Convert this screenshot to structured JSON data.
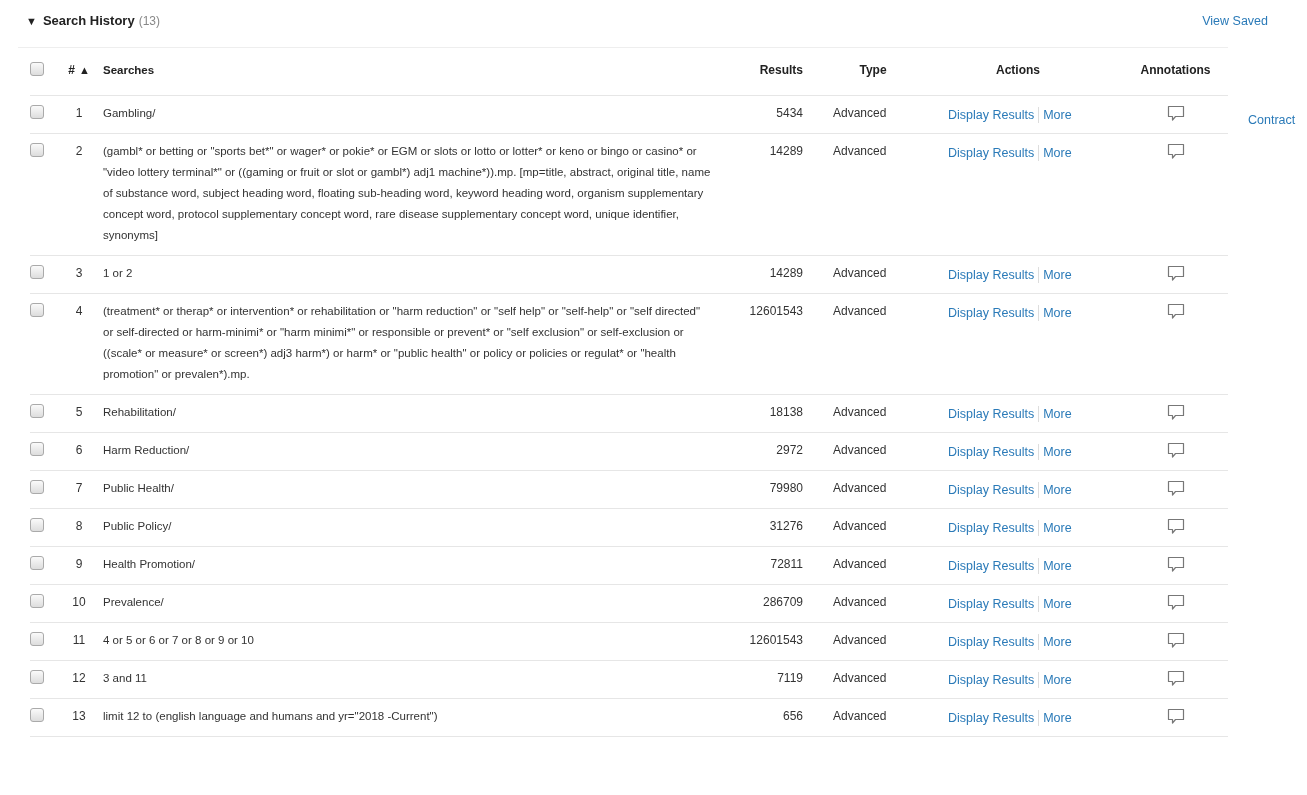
{
  "header": {
    "toggle": "▼",
    "title": "Search History",
    "count": "(13)",
    "view_saved": "View Saved"
  },
  "table": {
    "select_all_checked": false,
    "columns": {
      "number": "#",
      "sort_arrow": "▲",
      "searches": "Searches",
      "results": "Results",
      "type": "Type",
      "actions": "Actions",
      "annotations": "Annotations"
    },
    "rows": [
      {
        "checked": false,
        "number": "1",
        "search": "Gambling/",
        "results": "5434",
        "type": "Advanced",
        "display": "Display Results",
        "more": "More"
      },
      {
        "checked": false,
        "number": "2",
        "search": "(gambl* or betting or \"sports bet*\" or wager* or pokie* or EGM or slots or lotto or lotter* or keno or bingo or casino* or \"video lottery terminal*\" or ((gaming or fruit or slot or gambl*) adj1 machine*)).mp. [mp=title, abstract, original title, name of substance word, subject heading word, floating sub-heading word, keyword heading word, organism supplementary concept word, protocol supplementary concept word, rare disease supplementary concept word, unique identifier, synonyms]",
        "results": "14289",
        "type": "Advanced",
        "display": "Display Results",
        "more": "More"
      },
      {
        "checked": false,
        "number": "3",
        "search": "1 or 2",
        "results": "14289",
        "type": "Advanced",
        "display": "Display Results",
        "more": "More"
      },
      {
        "checked": false,
        "number": "4",
        "search": "(treatment* or therap* or intervention* or rehabilitation or \"harm reduction\" or \"self help\" or \"self-help\" or \"self directed\" or self-directed or harm-minimi* or \"harm minimi*\" or responsible or prevent* or \"self exclusion\" or self-exclusion or ((scale* or measure* or screen*) adj3 harm*) or harm* or \"public health\" or policy or policies or regulat* or \"health promotion\" or prevalen*).mp.",
        "results": "12601543",
        "type": "Advanced",
        "display": "Display Results",
        "more": "More"
      },
      {
        "checked": false,
        "number": "5",
        "search": "Rehabilitation/",
        "results": "18138",
        "type": "Advanced",
        "display": "Display Results",
        "more": "More"
      },
      {
        "checked": false,
        "number": "6",
        "search": "Harm Reduction/",
        "results": "2972",
        "type": "Advanced",
        "display": "Display Results",
        "more": "More"
      },
      {
        "checked": false,
        "number": "7",
        "search": "Public Health/",
        "results": "79980",
        "type": "Advanced",
        "display": "Display Results",
        "more": "More"
      },
      {
        "checked": false,
        "number": "8",
        "search": "Public Policy/",
        "results": "31276",
        "type": "Advanced",
        "display": "Display Results",
        "more": "More"
      },
      {
        "checked": false,
        "number": "9",
        "search": "Health Promotion/",
        "results": "72811",
        "type": "Advanced",
        "display": "Display Results",
        "more": "More"
      },
      {
        "checked": false,
        "number": "10",
        "search": "Prevalence/",
        "results": "286709",
        "type": "Advanced",
        "display": "Display Results",
        "more": "More"
      },
      {
        "checked": false,
        "number": "11",
        "search": "4 or 5 or 6 or 7 or 8 or 9 or 10",
        "results": "12601543",
        "type": "Advanced",
        "display": "Display Results",
        "more": "More"
      },
      {
        "checked": false,
        "number": "12",
        "search": "3 and 11",
        "results": "7119",
        "type": "Advanced",
        "display": "Display Results",
        "more": "More"
      },
      {
        "checked": false,
        "number": "13",
        "search": "limit 12 to (english language and humans and yr=\"2018 -Current\")",
        "results": "656",
        "type": "Advanced",
        "display": "Display Results",
        "more": "More"
      }
    ]
  },
  "contract": "Contract"
}
